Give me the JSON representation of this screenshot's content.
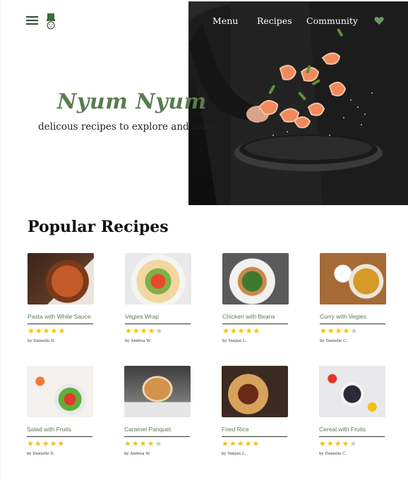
{
  "header": {
    "nav": [
      "Menu",
      "Recipes",
      "Community"
    ],
    "icons": [
      "hamburger-icon",
      "chef-logo-icon",
      "heart-icon"
    ],
    "accent_color": "#5a7c4f"
  },
  "hero": {
    "title": "Nyum Nyum",
    "tagline": "delicous recipes to explore and share!"
  },
  "popular": {
    "title": "Popular Recipes",
    "recipes": [
      {
        "name": "Pasta with White Sauce",
        "rating": 5,
        "author": "by Danielle D."
      },
      {
        "name": "Vegies Wrap",
        "rating": 4,
        "author": "by Andrea W."
      },
      {
        "name": "Chicken with Beans",
        "rating": 5,
        "author": "by Yanjun L."
      },
      {
        "name": "Curry with Vegies",
        "rating": 4,
        "author": "by Danielle C."
      },
      {
        "name": "Salad with Fruits",
        "rating": 5,
        "author": "by Danielle D."
      },
      {
        "name": "Caramel Panquet",
        "rating": 4,
        "author": "by Andrea W."
      },
      {
        "name": "Fried Rice",
        "rating": 5,
        "author": "by Yanjun L."
      },
      {
        "name": "Cereal with Fruits",
        "rating": 4,
        "author": "by Danielle C."
      }
    ]
  }
}
